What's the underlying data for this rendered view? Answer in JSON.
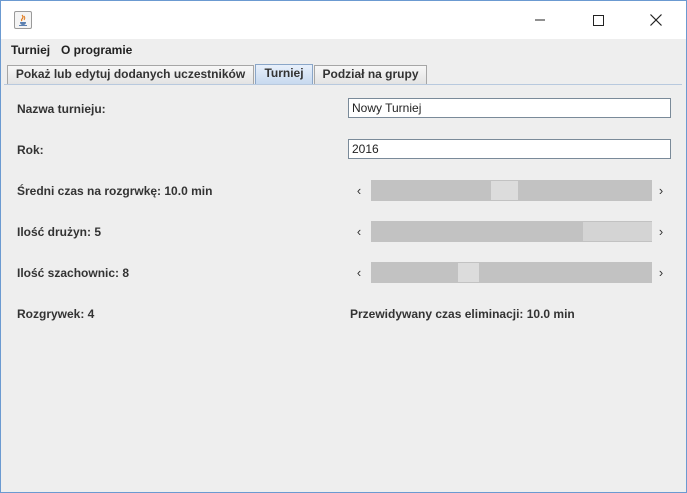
{
  "window": {
    "title": ""
  },
  "menubar": {
    "items": [
      "Turniej",
      "O programie"
    ]
  },
  "tabs": [
    {
      "label": "Pokaż lub edytuj dodanych uczestników",
      "active": false
    },
    {
      "label": "Turniej",
      "active": true
    },
    {
      "label": "Podział na grupy",
      "active": false
    }
  ],
  "form": {
    "name_label": "Nazwa turnieju:",
    "name_value": "Nowy Turniej",
    "year_label": "Rok:",
    "year_value": "2016",
    "avg_time_label": "Średni czas na rozgrwkę: 10.0 min",
    "teams_label": "Ilość drużyn: 5",
    "boards_label": "Ilość szachownic: 8",
    "games_label": "Rozgrywek: 4",
    "elimination_label": "Przewidywany czas eliminacji: 10.0 min"
  },
  "sliders": {
    "avg_time": {
      "value_fraction": 0.52
    },
    "teams": {
      "value_fraction": 0.78
    },
    "boards": {
      "value_fraction": 0.34
    }
  },
  "icons": {
    "app": "java-coffee-cup-icon",
    "minimize": "minimize-icon",
    "maximize": "maximize-icon",
    "close": "close-icon",
    "left": "chevron-left-icon",
    "right": "chevron-right-icon"
  },
  "colors": {
    "window_bg": "#eeeeee",
    "active_tab": "#c7d9ef",
    "window_border": "#6b9ad1",
    "scroll_track": "#c2c2c2",
    "scroll_thumb": "#dcdcdc"
  }
}
